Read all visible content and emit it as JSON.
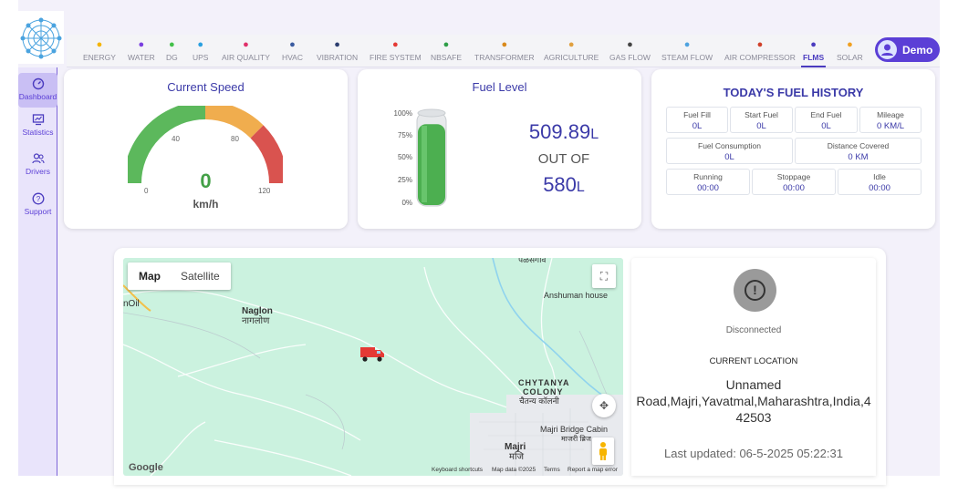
{
  "nav": {
    "items": [
      {
        "label": "ENERGY",
        "icon": "bolt-icon",
        "color": "#f5b400"
      },
      {
        "label": "WATER",
        "icon": "water-drop-icon",
        "color": "#7a3fe0"
      },
      {
        "label": "DG",
        "icon": "battery-icon",
        "color": "#43c04a"
      },
      {
        "label": "UPS",
        "icon": "ups-icon",
        "color": "#2aa0e0"
      },
      {
        "label": "AIR QUALITY",
        "icon": "air-quality-icon",
        "color": "#e0306a"
      },
      {
        "label": "HVAC",
        "icon": "hvac-icon",
        "color": "#3a5ba0"
      },
      {
        "label": "VIBRATION",
        "icon": "vibration-icon",
        "color": "#2c3e70"
      },
      {
        "label": "FIRE SYSTEM",
        "icon": "fire-icon",
        "color": "#e53935"
      },
      {
        "label": "NBSAFE",
        "icon": "shield-icon",
        "color": "#2e9e48"
      },
      {
        "label": "TRANSFORMER",
        "icon": "transformer-icon",
        "color": "#d98a1c"
      },
      {
        "label": "AGRICULTURE",
        "icon": "plant-icon",
        "color": "#e0a040"
      },
      {
        "label": "GAS FLOW",
        "icon": "gas-flow-icon",
        "color": "#444"
      },
      {
        "label": "STEAM FLOW",
        "icon": "steam-icon",
        "color": "#4fa3e0"
      },
      {
        "label": "AIR COMPRESSOR",
        "icon": "compressor-icon",
        "color": "#d0402a"
      },
      {
        "label": "FLMS",
        "icon": "truck-icon",
        "color": "#4a3bbf"
      },
      {
        "label": "SOLAR",
        "icon": "solar-icon",
        "color": "#f0a020"
      }
    ],
    "active": "FLMS"
  },
  "user": {
    "name": "Demo"
  },
  "sidebar": {
    "items": [
      {
        "label": "Dashboard",
        "icon": "dashboard-icon"
      },
      {
        "label": "Statistics",
        "icon": "statistics-icon"
      },
      {
        "label": "Drivers",
        "icon": "drivers-icon"
      },
      {
        "label": "Support",
        "icon": "help-icon"
      }
    ]
  },
  "speed": {
    "title": "Current Speed",
    "value": "0",
    "unit": "km/h",
    "ticks": [
      "0",
      "40",
      "80",
      "120"
    ],
    "colors": {
      "low": "#5cb85c",
      "mid": "#f0ad4e",
      "high": "#d9534f"
    }
  },
  "fuel": {
    "title": "Fuel Level",
    "percent_labels": [
      "100%",
      "75%",
      "50%",
      "25%",
      "0%"
    ],
    "level_fraction": 0.879,
    "current": "509.89",
    "capacity": "580",
    "unit": "L",
    "out_of": "OUT OF"
  },
  "history": {
    "title": "TODAY'S FUEL HISTORY",
    "row1": [
      {
        "label": "Fuel Fill",
        "value": "0L"
      },
      {
        "label": "Start Fuel",
        "value": "0L"
      },
      {
        "label": "End Fuel",
        "value": "0L"
      },
      {
        "label": "Mileage",
        "value": "0 KM/L"
      }
    ],
    "row2": [
      {
        "label": "Fuel Consumption",
        "value": "0L"
      },
      {
        "label": "Distance Covered",
        "value": "0 KM"
      }
    ],
    "row3": [
      {
        "label": "Running",
        "value": "00:00"
      },
      {
        "label": "Stoppage",
        "value": "00:00"
      },
      {
        "label": "Idle",
        "value": "00:00"
      }
    ]
  },
  "map": {
    "tab_map": "Map",
    "tab_satellite": "Satellite",
    "labels": {
      "top_village": "पळसगाव",
      "naglon": "Naglon",
      "naglon_local": "नागलोण",
      "anshuman": "Anshuman house",
      "chytanya": "CHYTANYA",
      "colony": "COLONY",
      "chytanya_local": "चैतन्य कॉलनी",
      "majri_bridge": "Majri Bridge Cabin",
      "majri_bridge_local": "माजरी ब्रिज",
      "majri": "Majri",
      "majri_local": "मजि",
      "oil": "nOil"
    },
    "footer": {
      "google": "Google",
      "shortcuts": "Keyboard shortcuts",
      "data": "Map data ©2025",
      "terms": "Terms",
      "report": "Report a map error"
    }
  },
  "status": {
    "state": "Disconnected",
    "location_heading": "CURRENT LOCATION",
    "address_line1": "Unnamed",
    "address_line2": "Road,Majri,Yavatmal,Maharashtra,India,4",
    "address_line3": "42503",
    "last_updated": "Last updated: 06-5-2025 05:22:31"
  }
}
